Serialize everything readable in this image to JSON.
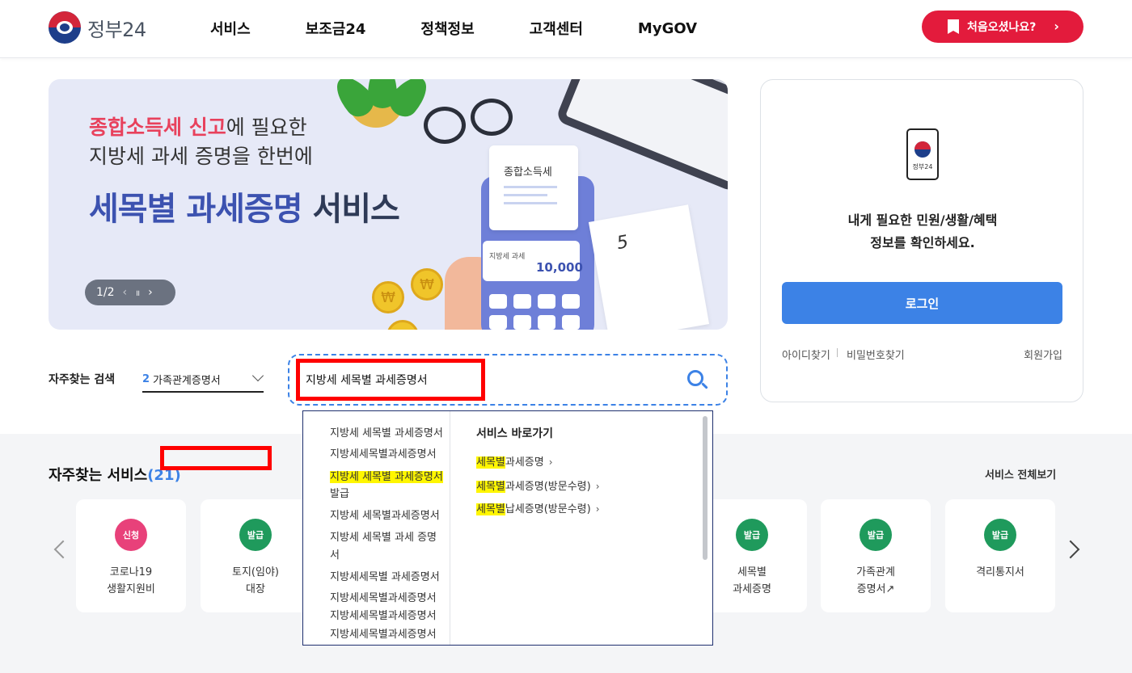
{
  "header": {
    "logo_text": "정부24",
    "nav": [
      "서비스",
      "보조금24",
      "정책정보",
      "고객센터",
      "MyGOV"
    ],
    "first_visit_button": "처음오셨나요?"
  },
  "banner": {
    "line1_highlight": "종합소득세 신고",
    "line1_rest": "에 필요한",
    "line2": "지방세 과세 증명을 한번에",
    "title_blue": "세목별 과세증명",
    "title_dark": " 서비스",
    "pager": {
      "current": "1/2",
      "prev": "‹",
      "pause": "॥",
      "next": "›"
    },
    "receipt_title": "종합소득세",
    "screen_label": "지방세 과세",
    "screen_value": "10,000",
    "calendar_day": "5"
  },
  "login": {
    "message_line1": "내게 필요한 민원/생활/혜택",
    "message_line2": "정보를 확인하세요.",
    "phone_text": "정부24",
    "button": "로그인",
    "find_id": "아이디찾기",
    "find_password": "비밀번호찾기",
    "signup": "회원가입"
  },
  "search": {
    "faq_label": "자주찾는 검색",
    "faq_selected_number": "2",
    "faq_selected_text": "가족관계증명서",
    "input_value": "지방세 세목별 과세증명서"
  },
  "autocomplete": {
    "suggestions": [
      {
        "pre": "",
        "mark": "",
        "post": "지방세 세목별 과세증명서"
      },
      {
        "pre": "",
        "mark": "",
        "post": "지방세세목별과세증명서"
      },
      {
        "pre": "",
        "mark": "지방세 세목별 과세증명서",
        "post": ""
      },
      {
        "pre": "",
        "mark": "",
        "post": "발급"
      },
      {
        "pre": "",
        "mark": "",
        "post": "지방세 세목별과세증명서"
      },
      {
        "pre": "",
        "mark": "",
        "post": "지방세 세목별 과세 증명"
      },
      {
        "pre": "",
        "mark": "",
        "post": "서"
      },
      {
        "pre": "",
        "mark": "",
        "post": "지방세세목별 과세증명서"
      },
      {
        "pre": "",
        "mark": "",
        "post": "지방세세목별과세증명서"
      },
      {
        "pre": "",
        "mark": "",
        "post": "지방세세목별과세증명서"
      },
      {
        "pre": "",
        "mark": "",
        "post": "지방세세목별과세증명서"
      }
    ],
    "quick_heading": "서비스 바로가기",
    "quick_links": [
      {
        "mark": "세목별",
        "rest": "과세증명"
      },
      {
        "mark": "세목별",
        "rest": "과세증명(방문수령)"
      },
      {
        "mark": "세목별",
        "rest": "납세증명(방문수령)"
      }
    ]
  },
  "services": {
    "title": "자주찾는 서비스",
    "count": "(21)",
    "view_all": "서비스 전체보기",
    "cards": [
      {
        "badge": "신청",
        "type": "apply",
        "line1": "코로나19",
        "line2": "생활지원비"
      },
      {
        "badge": "발급",
        "type": "issue",
        "line1": "토지(임야)",
        "line2": "대장"
      },
      {
        "badge": "발급",
        "type": "issue",
        "line1": "세목별",
        "line2": "과세증명"
      },
      {
        "badge": "발급",
        "type": "issue",
        "line1": "가족관계",
        "line2": "증명서↗"
      },
      {
        "badge": "발급",
        "type": "issue",
        "line1": "격리통지서",
        "line2": ""
      }
    ]
  },
  "colors": {
    "brand_red": "#e31b3c",
    "primary_blue": "#3c82e6",
    "highlight_yellow": "#fff600",
    "annotation_red": "#ff0000"
  }
}
